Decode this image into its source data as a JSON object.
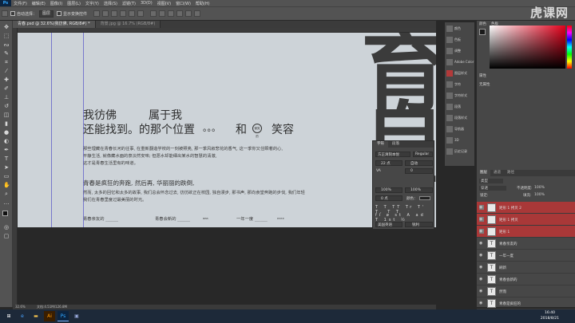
{
  "app": {
    "logo": "Ps",
    "menu": [
      "文件(F)",
      "编辑(E)",
      "图像(I)",
      "图层(L)",
      "文字(Y)",
      "选择(S)",
      "滤镜(T)",
      "3D(D)",
      "视图(V)",
      "窗口(W)",
      "帮助(H)"
    ]
  },
  "options_bar": {
    "auto_select_label": "自动选择：",
    "auto_select_value": "图层",
    "show_transform_label": "显示变换控件"
  },
  "watermark": "虎课网",
  "tabs": [
    {
      "label": "青春.psd @ 32.6%(我彷佛, RGB/8#) *"
    },
    {
      "label": "背景.jpg @ 16.7% (RGB/8#)"
    }
  ],
  "canvas": {
    "title_line1_a": "我彷佛",
    "title_line1_b": "属于我",
    "title_line2_a": "还能找到。的那个位置",
    "title_line2_dots": "。。。",
    "title_line2_and": "和",
    "stamp_text": "微笑的",
    "title_line2_end": "笑容",
    "para1": [
      "那些埋藏在青春长河的往事, 在重新翻造学校的一刻被照亮, 那一季风叙悲花的香气, 这一季你又住瞬着的心,",
      "平静生活, 就像藏水面的泉淡然安味; 但愿水却能细出某水的智慧的清澈,",
      "这才是青春生活里有的味道。"
    ],
    "heading2": "青春是疯狂的奔跑, 然后再, 华丽丽的跌倒,",
    "para2": [
      "然而, 太多的回忆和太多的故事, 我们总会怀念过去, 彷彷欲正在校园, 独自漫步, 那书声, 那向食堂奔跑的步伐, 我们年轻",
      "我们在青春里度过最美丽的时光。"
    ],
    "footer_items": [
      "青春亲友的 ______",
      "青春会新的 ______",
      "一年一度 ______"
    ],
    "footer_suffixes": [
      "",
      "BBB",
      "EEEE"
    ],
    "big_glyph_top": "育",
    "big_glyph_mid": "自",
    "big_glyph_bot": "言"
  },
  "char_panel": {
    "tab_char": "字符",
    "tab_para": "段落",
    "font_family": "方正清刻本悦",
    "font_style": "Regular",
    "size": "22 点",
    "leading": "自动",
    "tracking_label": "VA",
    "tracking": "0",
    "scale_v": "100%",
    "scale_h": "100%",
    "baseline": "0 点",
    "color_label": "颜色：",
    "lang": "美国英语",
    "aa": "锐利"
  },
  "props_items": [
    "颜色",
    "色板",
    "调整",
    "Adobe Color",
    "图层样式",
    "字符",
    "字符样式",
    "段落",
    "段落样式",
    "导航器",
    "3D",
    "历史记录"
  ],
  "right_panel": {
    "color_tab": "颜色",
    "swatches_tab": "色板",
    "properties_tab": "属性",
    "props_sub": "无属性"
  },
  "layers": {
    "tabs": [
      "图层",
      "通道",
      "路径"
    ],
    "kind": "类型",
    "mode": "穿透",
    "opacity_label": "不透明度:",
    "opacity": "100%",
    "fill_label": "填充:",
    "fill": "100%",
    "lock_label": "锁定:",
    "items": [
      {
        "name": "矩形 1 拷贝 2",
        "selected": true
      },
      {
        "name": "矩形 1 拷贝",
        "selected": true
      },
      {
        "name": "矩形 1",
        "selected": true
      },
      {
        "name": "青春亲友的",
        "selected": false
      },
      {
        "name": "一年一度",
        "selected": false
      },
      {
        "name": "刷新",
        "selected": false
      },
      {
        "name": "青春会新的",
        "selected": false
      },
      {
        "name": "然而",
        "selected": false
      },
      {
        "name": "青春是疯狂的",
        "selected": false
      }
    ]
  },
  "status": {
    "zoom": "32.6%",
    "doc": "文档:4.51M/126.8M"
  },
  "taskbar": {
    "time": "16:40",
    "date": "2018/8/21"
  }
}
